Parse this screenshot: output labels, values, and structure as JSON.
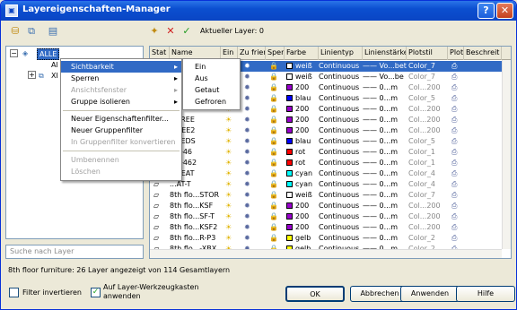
{
  "window": {
    "title": "Layereigenschaften-Manager",
    "help": "?",
    "close": "✕"
  },
  "toolbar": {
    "current_layer": "Aktueller Layer: 0"
  },
  "tree": {
    "root": "ALLE",
    "child1": "Al",
    "child2": "XI"
  },
  "search": {
    "placeholder": "Suche nach Layer"
  },
  "grid": {
    "headers": [
      "Stat",
      "Name",
      "Ein",
      "Zu frier",
      "Sper",
      "Farbe",
      "Linientyp",
      "Linienstärke",
      "Plotstil",
      "Plot",
      "Beschreit"
    ],
    "rows": [
      {
        "name": "",
        "color": "weiß",
        "swatch": "#ffffff",
        "linetype": "Continuous",
        "lineweight": "—— Vo...bet",
        "plotstyle": "Color_7",
        "selected": true
      },
      {
        "name": "",
        "color": "weiß",
        "swatch": "#ffffff",
        "linetype": "Continuous",
        "lineweight": "—— Vo...be",
        "plotstyle": "Color_7"
      },
      {
        "name": "",
        "color": "200",
        "swatch": "#9900cc",
        "linetype": "Continuous",
        "lineweight": "—— 0...m",
        "plotstyle": "Col...200"
      },
      {
        "name": "",
        "color": "blau",
        "swatch": "#0000ff",
        "linetype": "Continuous",
        "lineweight": "—— 0...m",
        "plotstyle": "Color_5"
      },
      {
        "name": "",
        "color": "200",
        "swatch": "#9900cc",
        "linetype": "Continuous",
        "lineweight": "—— 0...m",
        "plotstyle": "Col...200"
      },
      {
        "name": "...FREE",
        "color": "200",
        "swatch": "#9900cc",
        "linetype": "Continuous",
        "lineweight": "—— 0...m",
        "plotstyle": "Col...200"
      },
      {
        "name": "...REE2",
        "color": "200",
        "swatch": "#9900cc",
        "linetype": "Continuous",
        "lineweight": "—— 0...m",
        "plotstyle": "Col...200"
      },
      {
        "name": "...PEDS",
        "color": "blau",
        "swatch": "#0000ff",
        "linetype": "Continuous",
        "lineweight": "—— 0...m",
        "plotstyle": "Color_5"
      },
      {
        "name": "...L-46",
        "color": "rot",
        "swatch": "#ff0000",
        "linetype": "Continuous",
        "lineweight": "—— 0...m",
        "plotstyle": "Color_1"
      },
      {
        "name": "...L-462",
        "color": "rot",
        "swatch": "#ff0000",
        "linetype": "Continuous",
        "lineweight": "—— 0...m",
        "plotstyle": "Color_1"
      },
      {
        "name": "...SEAT",
        "color": "cyan",
        "swatch": "#00ffff",
        "linetype": "Continuous",
        "lineweight": "—— 0...m",
        "plotstyle": "Color_4"
      },
      {
        "name": "...AT-T",
        "color": "cyan",
        "swatch": "#00ffff",
        "linetype": "Continuous",
        "lineweight": "—— 0...m",
        "plotstyle": "Color_4"
      },
      {
        "name": "8th flo...STOR",
        "color": "weiß",
        "swatch": "#ffffff",
        "linetype": "Continuous",
        "lineweight": "—— 0...m",
        "plotstyle": "Color_7"
      },
      {
        "name": "8th flo...KSF",
        "color": "200",
        "swatch": "#9900cc",
        "linetype": "Continuous",
        "lineweight": "—— 0...m",
        "plotstyle": "Col...200"
      },
      {
        "name": "8th flo...SF-T",
        "color": "200",
        "swatch": "#9900cc",
        "linetype": "Continuous",
        "lineweight": "—— 0...m",
        "plotstyle": "Col...200"
      },
      {
        "name": "8th flo...KSF2",
        "color": "200",
        "swatch": "#9900cc",
        "linetype": "Continuous",
        "lineweight": "—— 0...m",
        "plotstyle": "Col...200"
      },
      {
        "name": "8th flo...R-P3",
        "color": "gelb",
        "swatch": "#ffff00",
        "linetype": "Continuous",
        "lineweight": "—— 0...m",
        "plotstyle": "Color_2"
      },
      {
        "name": "8th flo...-XBX",
        "color": "gelb",
        "swatch": "#ffff00",
        "linetype": "Continuous",
        "lineweight": "—— 0...m",
        "plotstyle": "Color_2"
      }
    ]
  },
  "context_menu": {
    "items": [
      "Sichtbarkeit",
      "Sperren",
      "Ansichtsfenster",
      "Gruppe isolieren",
      "Neuer Eigenschaftenfilter...",
      "Neuer Gruppenfilter",
      "In Gruppenfilter konvertieren",
      "Umbenennen",
      "Löschen"
    ],
    "submenu": [
      "Ein",
      "Aus",
      "Getaut",
      "Gefroren"
    ]
  },
  "status": {
    "text": "8th floor furniture: 26 Layer angezeigt von 114 Gesamtlayern"
  },
  "options": {
    "invert_filter": "Filter invertieren",
    "apply_toolbar": "Auf Layer-Werkzeugkasten anwenden"
  },
  "buttons": {
    "ok": "OK",
    "cancel": "Abbrechen",
    "apply": "Anwenden",
    "help": "Hilfe"
  }
}
